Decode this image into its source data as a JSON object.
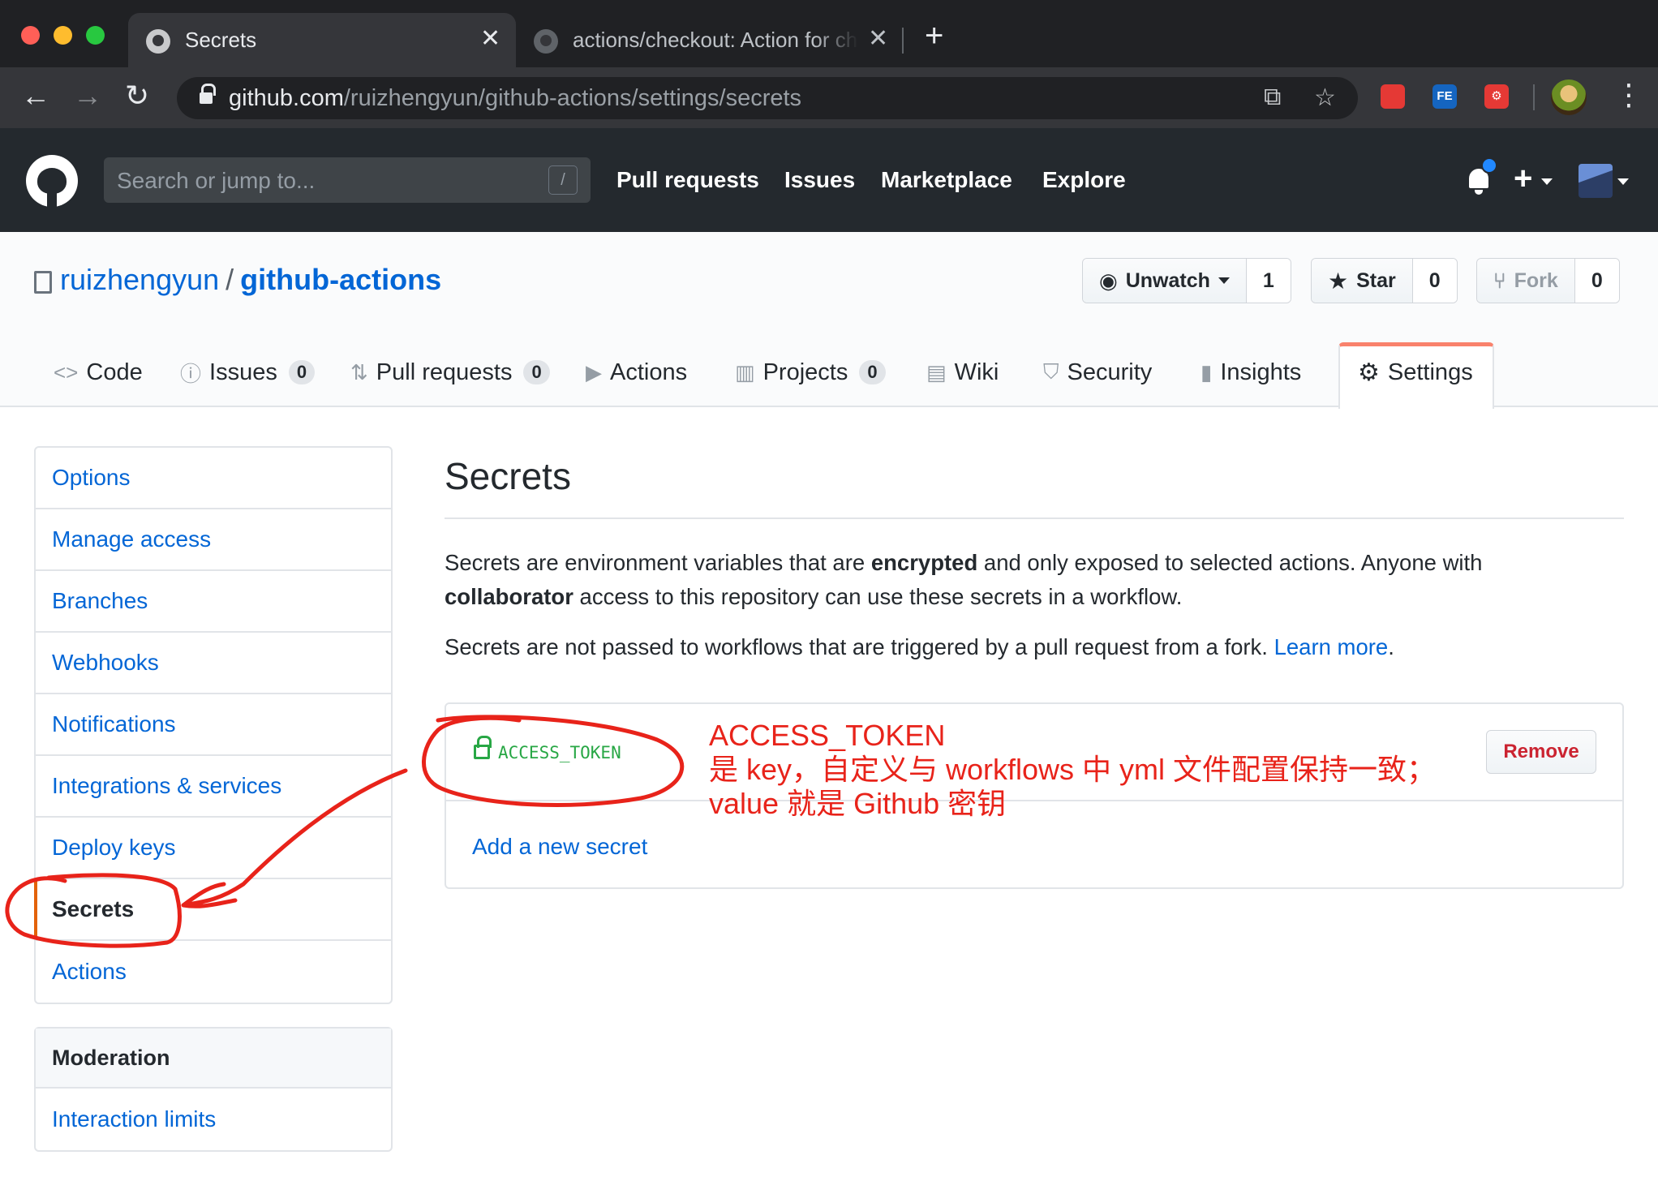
{
  "browser": {
    "tabs": [
      {
        "title": "Secrets",
        "close": "✕"
      },
      {
        "title": "actions/checkout: Action for checking out a repo",
        "close": "✕"
      }
    ],
    "new_tab": "+",
    "url_host": "github.com",
    "url_path": "/ruizhengyun/github-actions/settings/secrets",
    "extensions": [
      {
        "label": "",
        "color": "#e53935"
      },
      {
        "label": "FE",
        "color": "#1565c0"
      },
      {
        "label": "⚙",
        "color": "#e53935"
      }
    ]
  },
  "github": {
    "search_placeholder": "Search or jump to...",
    "search_key": "/",
    "nav": [
      "Pull requests",
      "Issues",
      "Marketplace",
      "Explore"
    ]
  },
  "repo": {
    "owner": "ruizhengyun",
    "separator": "/",
    "name": "github-actions",
    "unwatch": {
      "label": "Unwatch",
      "count": "1"
    },
    "star": {
      "label": "Star",
      "count": "0"
    },
    "fork": {
      "label": "Fork",
      "count": "0"
    },
    "tabs": [
      {
        "label": "Code"
      },
      {
        "label": "Issues",
        "count": "0"
      },
      {
        "label": "Pull requests",
        "count": "0"
      },
      {
        "label": "Actions"
      },
      {
        "label": "Projects",
        "count": "0"
      },
      {
        "label": "Wiki"
      },
      {
        "label": "Security"
      },
      {
        "label": "Insights"
      },
      {
        "label": "Settings"
      }
    ]
  },
  "sidebar": {
    "items": [
      "Options",
      "Manage access",
      "Branches",
      "Webhooks",
      "Notifications",
      "Integrations & services",
      "Deploy keys",
      "Secrets",
      "Actions"
    ],
    "moderation_heading": "Moderation",
    "moderation_items": [
      "Interaction limits"
    ]
  },
  "main": {
    "title": "Secrets",
    "p1_a": "Secrets are environment variables that are ",
    "p1_b": "encrypted",
    "p1_c": " and only exposed to selected actions. Anyone with",
    "p1_d": "collaborator",
    "p1_e": " access to this repository can use these secrets in a workflow.",
    "p2_a": "Secrets are not passed to workflows that are triggered by a pull request from a fork. ",
    "p2_link": "Learn more",
    "p2_end": ".",
    "secret_name": "ACCESS_TOKEN",
    "remove_label": "Remove",
    "add_secret": "Add a new secret"
  },
  "annotation": {
    "line1": "ACCESS_TOKEN",
    "line2": "是 key，自定义与 workflows 中 yml 文件配置保持一致；",
    "line3": "value 就是 Github 密钥",
    "color": "#e8231a"
  }
}
